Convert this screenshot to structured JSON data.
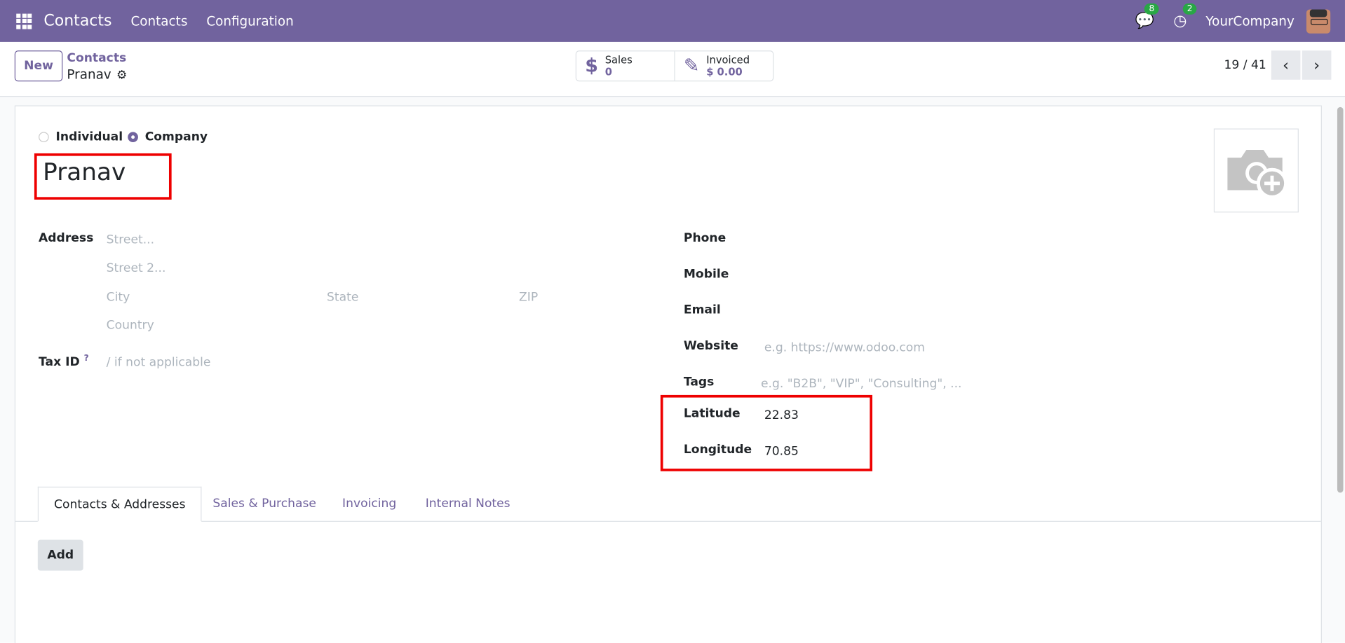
{
  "topbar": {
    "app": "Contacts",
    "menu": [
      "Contacts",
      "Configuration"
    ],
    "messages_count": "8",
    "activities_count": "2",
    "company": "YourCompany"
  },
  "control": {
    "new_label": "New",
    "breadcrumb_parent": "Contacts",
    "breadcrumb_current": "Pranav",
    "stats": [
      {
        "label": "Sales",
        "value": "0"
      },
      {
        "label": "Invoiced",
        "value": "$ 0.00"
      }
    ],
    "pager": "19 / 41"
  },
  "form": {
    "type_options": [
      "Individual",
      "Company"
    ],
    "selected_type": "Company",
    "name": "Pranav",
    "address_label": "Address",
    "street_ph": "Street...",
    "street2_ph": "Street 2...",
    "city_ph": "City",
    "state_ph": "State",
    "zip_ph": "ZIP",
    "country_ph": "Country",
    "taxid_label": "Tax ID",
    "taxid_help": "?",
    "taxid_ph": "/ if not applicable",
    "phone_label": "Phone",
    "mobile_label": "Mobile",
    "email_label": "Email",
    "website_label": "Website",
    "website_ph": "e.g. https://www.odoo.com",
    "tags_label": "Tags",
    "tags_ph": "e.g. \"B2B\", \"VIP\", \"Consulting\", ...",
    "latitude_label": "Latitude",
    "latitude": "22.83",
    "longitude_label": "Longitude",
    "longitude": "70.85"
  },
  "tabs": [
    "Contacts & Addresses",
    "Sales & Purchase",
    "Invoicing",
    "Internal Notes"
  ],
  "add_label": "Add"
}
